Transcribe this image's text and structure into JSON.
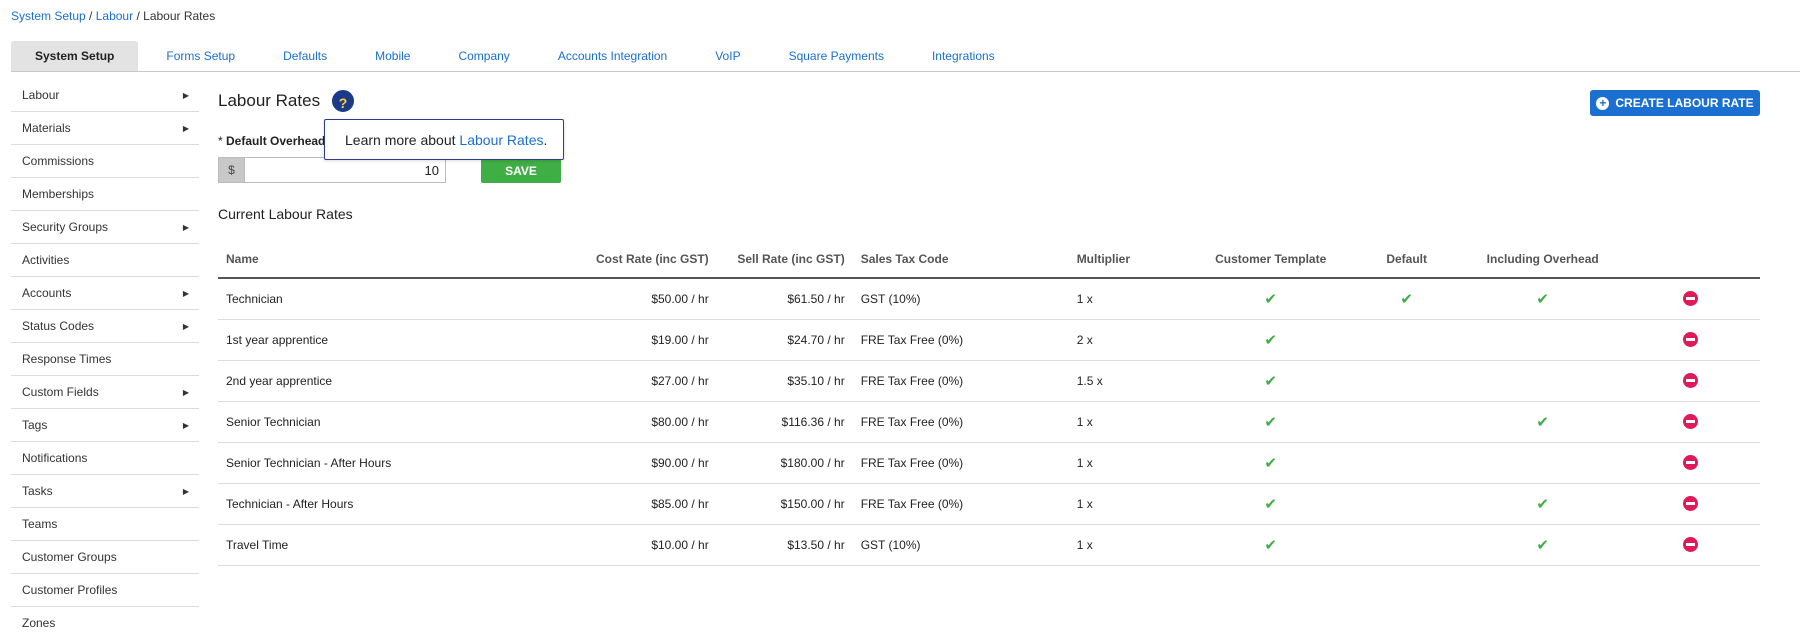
{
  "breadcrumb": {
    "crumbs": [
      "System Setup",
      "Labour"
    ],
    "separator": "/",
    "current": "Labour Rates"
  },
  "tabs": [
    "System Setup",
    "Forms Setup",
    "Defaults",
    "Mobile",
    "Company",
    "Accounts Integration",
    "VoIP",
    "Square Payments",
    "Integrations"
  ],
  "active_tab": "System Setup",
  "sidebar": {
    "items": [
      {
        "label": "Labour",
        "has_submenu": true
      },
      {
        "label": "Materials",
        "has_submenu": true
      },
      {
        "label": "Commissions",
        "has_submenu": false
      },
      {
        "label": "Memberships",
        "has_submenu": false
      },
      {
        "label": "Security Groups",
        "has_submenu": true
      },
      {
        "label": "Activities",
        "has_submenu": false
      },
      {
        "label": "Accounts",
        "has_submenu": true
      },
      {
        "label": "Status Codes",
        "has_submenu": true
      },
      {
        "label": "Response Times",
        "has_submenu": false
      },
      {
        "label": "Custom Fields",
        "has_submenu": true
      },
      {
        "label": "Tags",
        "has_submenu": true
      },
      {
        "label": "Notifications",
        "has_submenu": false
      },
      {
        "label": "Tasks",
        "has_submenu": true
      },
      {
        "label": "Teams",
        "has_submenu": false
      },
      {
        "label": "Customer Groups",
        "has_submenu": false
      },
      {
        "label": "Customer Profiles",
        "has_submenu": false
      },
      {
        "label": "Zones",
        "has_submenu": false
      }
    ]
  },
  "main": {
    "title": "Labour Rates",
    "help_glyph": "?",
    "tooltip": {
      "text": "Learn more about",
      "link": "Labour Rates",
      "suffix": "."
    },
    "create_button": "CREATE LABOUR RATE",
    "overhead": {
      "required_mark": "*",
      "label": "Default Overhead:",
      "currency": "$",
      "value": "10"
    },
    "save_button": "SAVE",
    "section_title": "Current Labour Rates",
    "table": {
      "columns": [
        "Name",
        "Cost Rate (inc GST)",
        "Sell Rate (inc GST)",
        "Sales Tax Code",
        "Multiplier",
        "Customer Template",
        "Default",
        "Including Overhead",
        ""
      ],
      "rows": [
        {
          "name": "Technician",
          "cost": "$50.00 / hr",
          "sell": "$61.50 / hr",
          "tax": "GST (10%)",
          "multiplier": "1 x",
          "customer_template": true,
          "default": true,
          "overhead": true
        },
        {
          "name": "1st year apprentice",
          "cost": "$19.00 / hr",
          "sell": "$24.70 / hr",
          "tax": "FRE Tax Free (0%)",
          "multiplier": "2 x",
          "customer_template": true,
          "default": false,
          "overhead": false
        },
        {
          "name": "2nd year apprentice",
          "cost": "$27.00 / hr",
          "sell": "$35.10 / hr",
          "tax": "FRE Tax Free (0%)",
          "multiplier": "1.5 x",
          "customer_template": true,
          "default": false,
          "overhead": false
        },
        {
          "name": "Senior Technician",
          "cost": "$80.00 / hr",
          "sell": "$116.36 / hr",
          "tax": "FRE Tax Free (0%)",
          "multiplier": "1 x",
          "customer_template": true,
          "default": false,
          "overhead": true
        },
        {
          "name": "Senior Technician - After Hours",
          "cost": "$90.00 / hr",
          "sell": "$180.00 / hr",
          "tax": "FRE Tax Free (0%)",
          "multiplier": "1 x",
          "customer_template": true,
          "default": false,
          "overhead": false
        },
        {
          "name": "Technician - After Hours",
          "cost": "$85.00 / hr",
          "sell": "$150.00 / hr",
          "tax": "FRE Tax Free (0%)",
          "multiplier": "1 x",
          "customer_template": true,
          "default": false,
          "overhead": true
        },
        {
          "name": "Travel Time",
          "cost": "$10.00 / hr",
          "sell": "$13.50 / hr",
          "tax": "GST (10%)",
          "multiplier": "1 x",
          "customer_template": true,
          "default": false,
          "overhead": true
        }
      ]
    }
  },
  "colors": {
    "link": "#1a6fd1",
    "primary": "#1a6fd1",
    "success": "#3fae45",
    "danger": "#e0195a",
    "help_bg": "#1b3a8a",
    "help_fg": "#ffd12a"
  },
  "icons": {
    "submenu": "caret-right-icon",
    "check": "check-icon",
    "delete": "delete-circle-icon",
    "create": "plus-circle-icon",
    "help": "question-circle-icon"
  }
}
